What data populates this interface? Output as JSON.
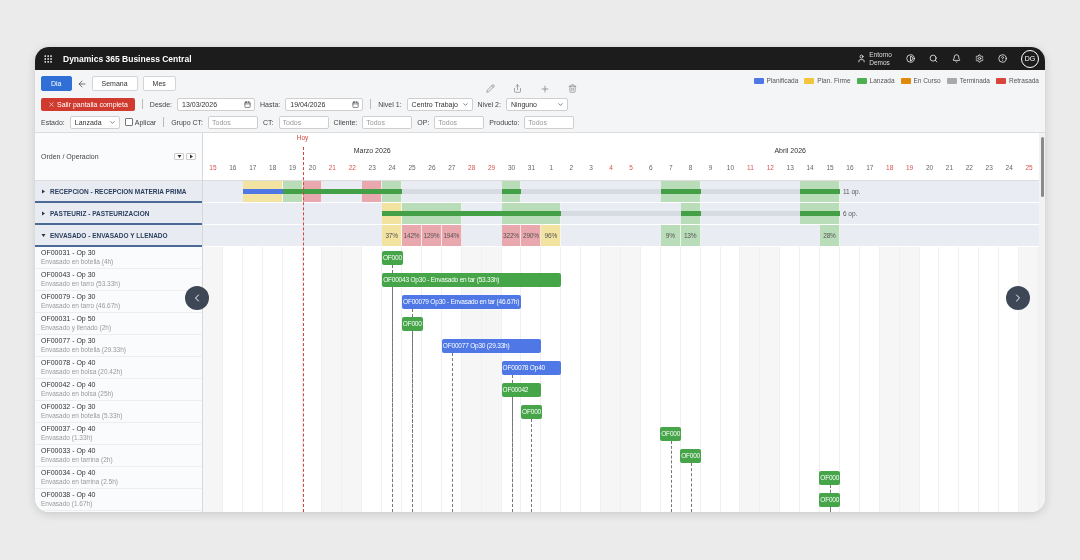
{
  "top_bar": {
    "app_title": "Dynamics 365 Business Central",
    "environment": [
      "Entorno",
      "Demos"
    ],
    "avatar": "DG"
  },
  "toolbar": {
    "views": [
      {
        "label": "Dia",
        "selected": true
      },
      {
        "label": "Semana",
        "selected": false
      },
      {
        "label": "Mes",
        "selected": false
      }
    ],
    "legend": [
      {
        "label": "Planificada",
        "color": "#4f78e6"
      },
      {
        "label": "Plan. Firme",
        "color": "#f2c53d"
      },
      {
        "label": "Lanzada",
        "color": "#4caf50"
      },
      {
        "label": "En Curso",
        "color": "#e08a0b"
      },
      {
        "label": "Terminada",
        "color": "#a9a9a9"
      },
      {
        "label": "Retrasada",
        "color": "#d9453a"
      }
    ],
    "exit_button": "Salir pantalla completa",
    "from": {
      "label": "Desde:",
      "value": "13/03/2026"
    },
    "to": {
      "label": "Hasta:",
      "value": "19/04/2026"
    },
    "level1": {
      "label": "Nivel 1:",
      "value": "Centro Trabajo"
    },
    "level2": {
      "label": "Nivel 2:",
      "value": "Ninguno"
    },
    "status": {
      "label": "Estado:",
      "value": "Lanzada"
    },
    "apply": {
      "label": "Aplicar",
      "checked": false
    },
    "filters": [
      {
        "label": "Grupo CT:",
        "placeholder": "Todos"
      },
      {
        "label": "CT:",
        "placeholder": "Todos"
      },
      {
        "label": "Cliente:",
        "placeholder": "Todos"
      },
      {
        "label": "OP:",
        "placeholder": "Todos"
      },
      {
        "label": "Producto:",
        "placeholder": "Todos"
      }
    ]
  },
  "left_header": "Orden / Operacion",
  "timeline": {
    "today_label": "Hoy",
    "months": [
      {
        "label": "Marzo 2026",
        "days": [
          {
            "label": "15",
            "weekend": true,
            "today": false
          },
          {
            "label": "16",
            "weekend": false,
            "today": false
          },
          {
            "label": "17",
            "weekend": false,
            "today": false
          },
          {
            "label": "18",
            "weekend": false,
            "today": false
          },
          {
            "label": "19",
            "weekend": false,
            "today": false
          },
          {
            "label": "20",
            "weekend": false,
            "today": true
          },
          {
            "label": "21",
            "weekend": true,
            "today": false
          },
          {
            "label": "22",
            "weekend": true,
            "today": false
          },
          {
            "label": "23",
            "weekend": false,
            "today": false
          },
          {
            "label": "24",
            "weekend": false,
            "today": false
          },
          {
            "label": "25",
            "weekend": false,
            "today": false
          },
          {
            "label": "26",
            "weekend": false,
            "today": false
          },
          {
            "label": "27",
            "weekend": false,
            "today": false
          },
          {
            "label": "28",
            "weekend": true,
            "today": false
          },
          {
            "label": "29",
            "weekend": true,
            "today": false
          },
          {
            "label": "30",
            "weekend": false,
            "today": false
          },
          {
            "label": "31",
            "weekend": false,
            "today": false
          }
        ]
      },
      {
        "label": "Abril 2026",
        "days": [
          {
            "label": "1",
            "weekend": false,
            "today": false
          },
          {
            "label": "2",
            "weekend": false,
            "today": false
          },
          {
            "label": "3",
            "weekend": false,
            "today": false
          },
          {
            "label": "4",
            "weekend": true,
            "today": false
          },
          {
            "label": "5",
            "weekend": true,
            "today": false
          },
          {
            "label": "6",
            "weekend": false,
            "today": false
          },
          {
            "label": "7",
            "weekend": false,
            "today": false
          },
          {
            "label": "8",
            "weekend": false,
            "today": false
          },
          {
            "label": "9",
            "weekend": false,
            "today": false
          },
          {
            "label": "10",
            "weekend": false,
            "today": false
          },
          {
            "label": "11",
            "weekend": true,
            "today": false
          },
          {
            "label": "12",
            "weekend": true,
            "today": false
          },
          {
            "label": "13",
            "weekend": false,
            "today": false
          },
          {
            "label": "14",
            "weekend": false,
            "today": false
          },
          {
            "label": "15",
            "weekend": false,
            "today": false
          },
          {
            "label": "16",
            "weekend": false,
            "today": false
          },
          {
            "label": "17",
            "weekend": false,
            "today": false
          },
          {
            "label": "18",
            "weekend": true,
            "today": false
          },
          {
            "label": "19",
            "weekend": true,
            "today": false
          },
          {
            "label": "20",
            "weekend": false,
            "today": false
          },
          {
            "label": "21",
            "weekend": false,
            "today": false
          },
          {
            "label": "22",
            "weekend": false,
            "today": false
          },
          {
            "label": "23",
            "weekend": false,
            "today": false
          },
          {
            "label": "24",
            "weekend": false,
            "today": false
          },
          {
            "label": "25",
            "weekend": true,
            "today": false
          }
        ]
      }
    ]
  },
  "groups": [
    {
      "label": "RECEPCION - RECEPCION MATERIA PRIMA",
      "expanded": false,
      "count": "11 op.",
      "cells": [
        {
          "color": "#f3e3a0"
        },
        {
          "color": "#b9dcb9"
        },
        {
          "color": "#e9a8ad"
        },
        {
          "color": "#e9a8ad"
        },
        {
          "color": "#b9dcb9"
        },
        {
          "color": "#b9dcb9"
        },
        {
          "color": "#b9dcb9"
        },
        {
          "color": "#b9dcb9"
        }
      ],
      "segments": [
        {
          "color": "#4f78e6"
        },
        {
          "color": "#44a047"
        },
        {
          "color": "#44a047"
        },
        {
          "color": "#44a047"
        },
        {
          "color": "#44a047"
        }
      ]
    },
    {
      "label": "PASTEURIZ - PASTEURIZACION",
      "expanded": false,
      "count": "6 op.",
      "cells": [
        {
          "color": "#f3e3a0"
        },
        {
          "color": "#b9dcb9"
        },
        {
          "color": "#b9dcb9"
        },
        {
          "color": "#b9dcb9"
        },
        {
          "color": "#b9dcb9"
        }
      ],
      "segments": [
        {
          "color": "#44a047"
        },
        {
          "color": "#44a047"
        },
        {
          "color": "#44a047"
        }
      ]
    },
    {
      "label": "ENVASADO - ENVASADO Y LLENADO",
      "expanded": true,
      "cells": [
        {
          "color": "#f3e3a0",
          "label": "37%"
        },
        {
          "color": "#e9a8ad",
          "label": "142%"
        },
        {
          "color": "#e9a8ad",
          "label": "129%"
        },
        {
          "color": "#e9a8ad",
          "label": "194%"
        },
        {
          "color": "#e9a8ad",
          "label": "322%"
        },
        {
          "color": "#e9a8ad",
          "label": "290%"
        },
        {
          "color": "#f3e3a0",
          "label": "96%"
        },
        {
          "color": "#b9dcb9",
          "label": "9%"
        },
        {
          "color": "#b9dcb9",
          "label": "13%"
        },
        {
          "color": "#b9dcb9",
          "label": "28%"
        }
      ]
    }
  ],
  "operations": [
    {
      "order": "OF00031 - Op 30",
      "detail": "Envasado en botella (4h)",
      "bar": {
        "label": "OF000",
        "color": "#45a548"
      }
    },
    {
      "order": "OF00043 - Op 30",
      "detail": "Envasado en tarro (53.33h)",
      "bar": {
        "label": "OF00043 Op30 - Envasado en tar (53.33h)",
        "color": "#45a548"
      }
    },
    {
      "order": "OF00079 - Op 30",
      "detail": "Envasado en tarro (46.67h)",
      "bar": {
        "label": "OF00079 Op30 - Envasado en tar (46.67h)",
        "color": "#4f78e6"
      }
    },
    {
      "order": "OF00031 - Op 50",
      "detail": "Envasado y llenado (2h)",
      "bar": {
        "label": "OF000",
        "color": "#45a548"
      }
    },
    {
      "order": "OF00077 - Op 30",
      "detail": "Envasado en botella (29.33h)",
      "bar": {
        "label": "OF00077 Op30 (29.33h)",
        "color": "#4f78e6"
      }
    },
    {
      "order": "OF00078 - Op 40",
      "detail": "Envasado en bolsa (20.42h)",
      "bar": {
        "label": "OF00078 Op40",
        "color": "#4f78e6"
      }
    },
    {
      "order": "OF00042 - Op 40",
      "detail": "Envasado en bolsa (25h)",
      "bar": {
        "label": "OF00042",
        "color": "#45a548"
      }
    },
    {
      "order": "OF00032 - Op 30",
      "detail": "Envasado en botella (5.33h)",
      "bar": {
        "label": "OF000",
        "color": "#45a548"
      }
    },
    {
      "order": "OF00037 - Op 40",
      "detail": "Envasado (1.33h)",
      "bar": {
        "label": "OF000",
        "color": "#45a548"
      }
    },
    {
      "order": "OF00033 - Op 40",
      "detail": "Envasado en tarrina (2h)",
      "bar": {
        "label": "OF000",
        "color": "#45a548"
      }
    },
    {
      "order": "OF00034 - Op 40",
      "detail": "Envasado en tarrina (2.5h)",
      "bar": {
        "label": "OF000",
        "color": "#45a548"
      }
    },
    {
      "order": "OF00038 - Op 40",
      "detail": "Envasado (1.67h)",
      "bar": {
        "label": "OF000",
        "color": "#45a548"
      }
    }
  ]
}
